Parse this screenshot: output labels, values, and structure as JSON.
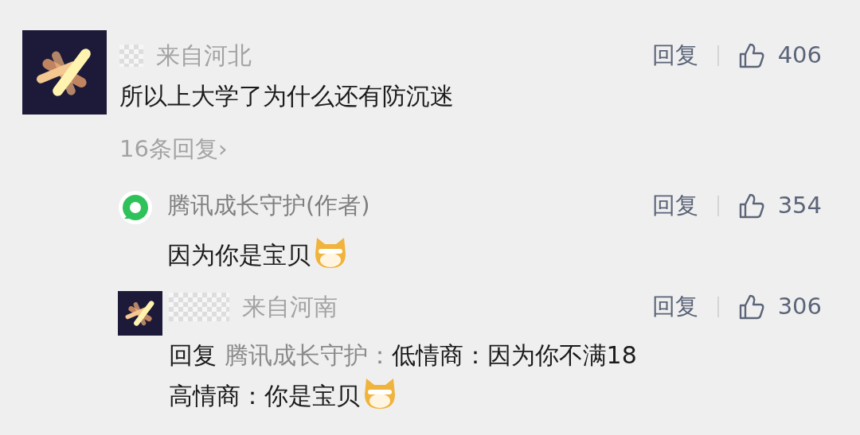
{
  "comment": {
    "author_hidden": true,
    "location": "来自河北",
    "text": "所以上大学了为什么还有防沉迷",
    "trailing_emoji": false,
    "reply_label": "回复",
    "likes": "406",
    "reply_count": "16条回复",
    "chevron": "›"
  },
  "replies": [
    {
      "author_hidden": false,
      "author": "腾讯成长守护(作者)",
      "lines": [
        "因为你是宝贝"
      ],
      "trailing_emoji": true,
      "reply_label": "回复",
      "likes": "354"
    },
    {
      "author_hidden": true,
      "location": "来自河南",
      "reply_prefix": "回复",
      "mention": "腾讯成长守护：",
      "lines": [
        "低情商：因为你不满18",
        "高情商：你是宝贝"
      ],
      "trailing_emoji": true,
      "reply_label": "回复",
      "likes": "306"
    }
  ]
}
